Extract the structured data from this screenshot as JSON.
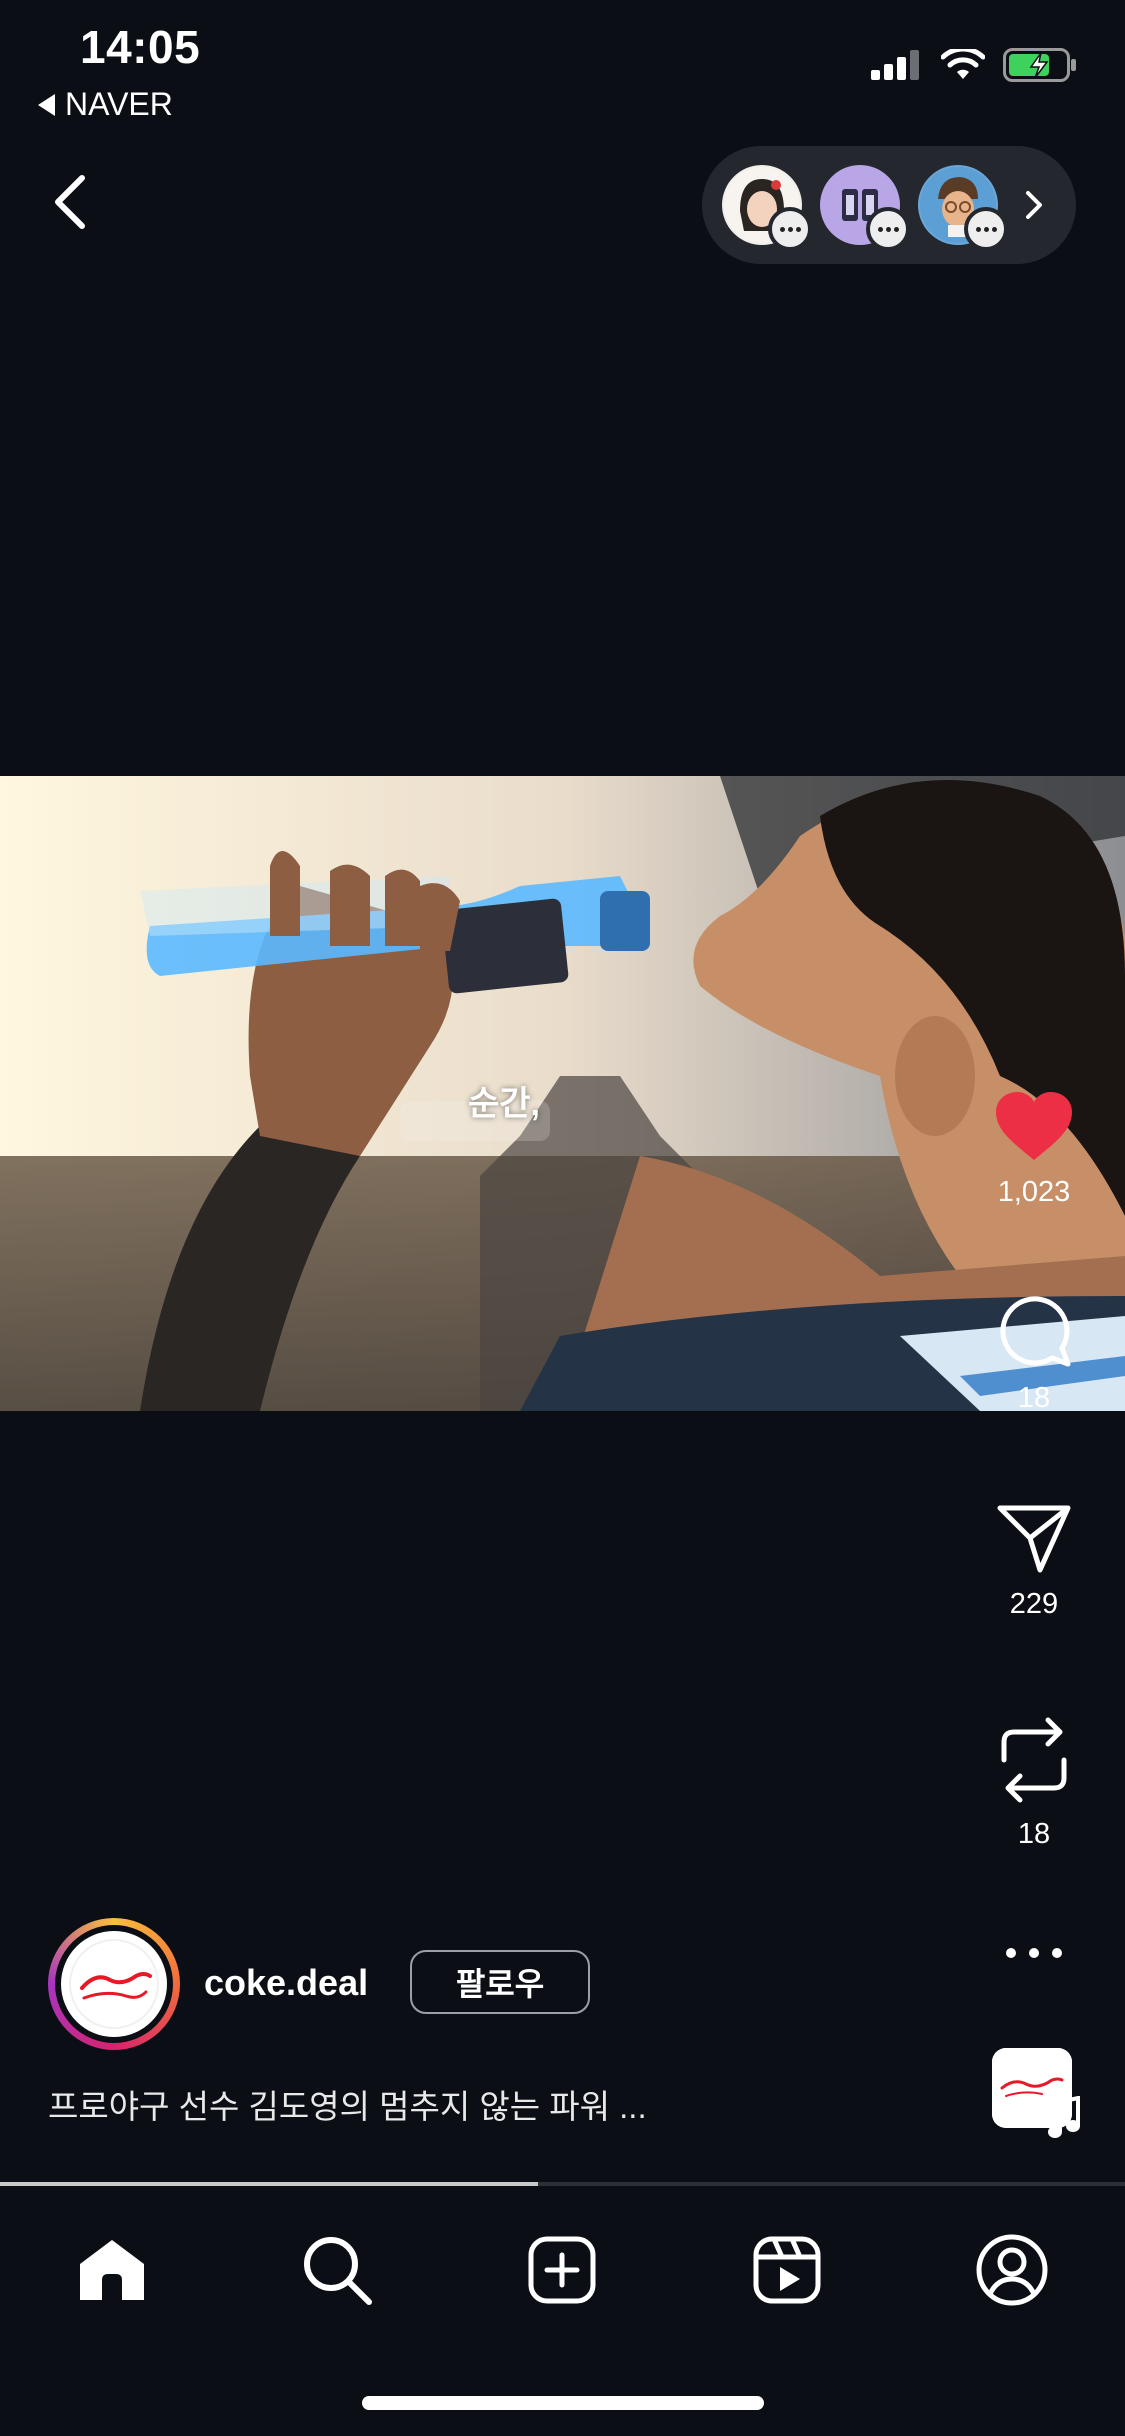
{
  "status_bar": {
    "time": "14:05",
    "back_app": "NAVER"
  },
  "header": {
    "avatars": [
      {
        "name": "avatar-1",
        "color": "#f2efe9"
      },
      {
        "name": "avatar-2",
        "color": "#b9a6e6"
      },
      {
        "name": "avatar-3",
        "color": "#6aa7d8"
      }
    ]
  },
  "video": {
    "subtitle": "순간,"
  },
  "actions": {
    "likes": "1,023",
    "comments": "18",
    "shares": "229",
    "reposts": "18",
    "like_color": "#ed2f45"
  },
  "post": {
    "username": "coke.deal",
    "follow_label": "팔로우",
    "caption": "프로야구 선수 김도영의 멈추지 않는 파워 ...",
    "progress": 0.478
  },
  "tabs": [
    "home-icon",
    "search-icon",
    "create-icon",
    "reels-icon",
    "profile-icon"
  ]
}
